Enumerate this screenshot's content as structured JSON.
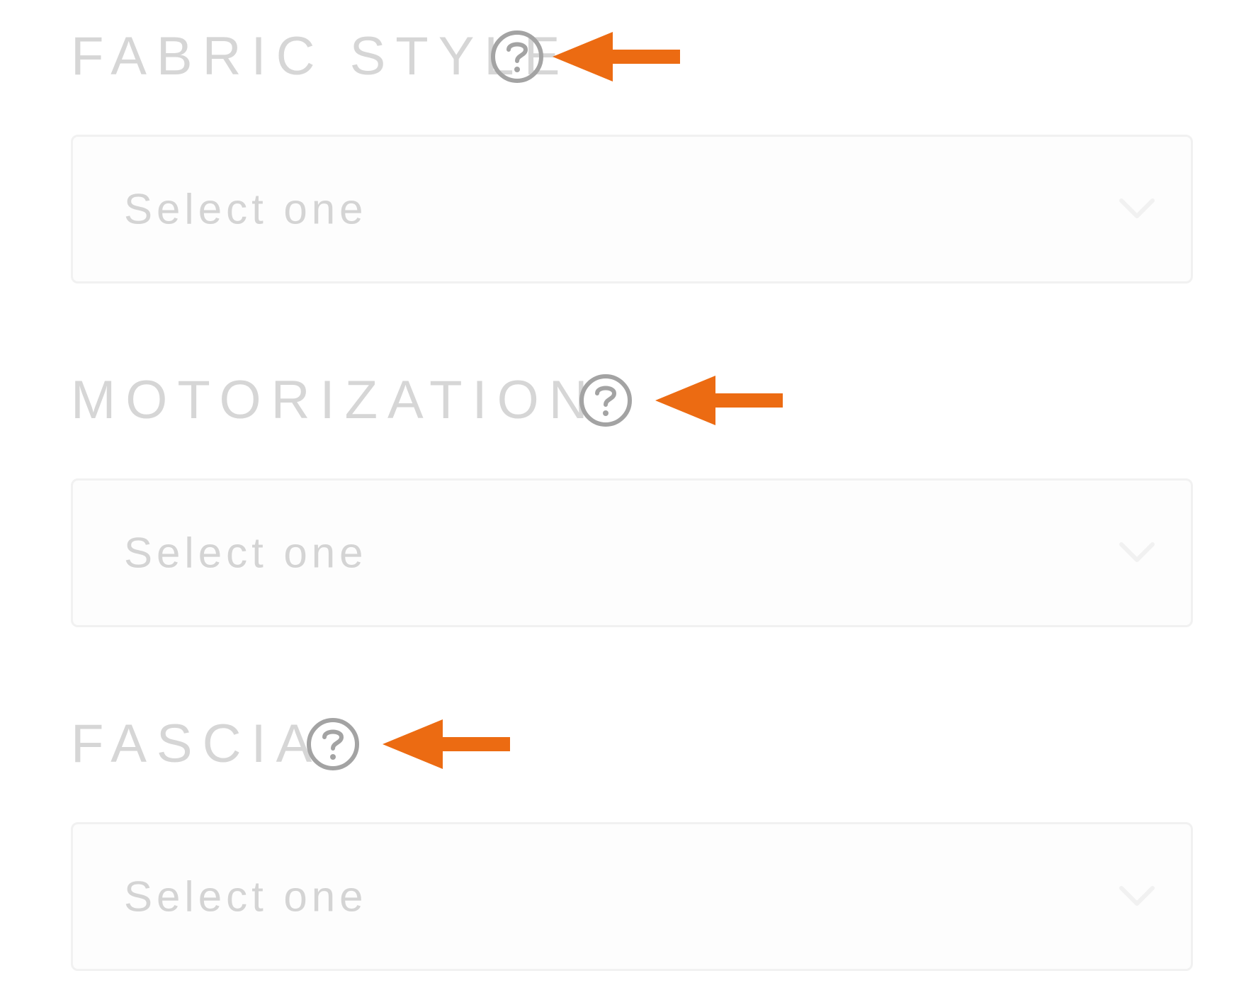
{
  "fields": [
    {
      "label": "FABRIC STYLE",
      "select": {
        "value": "Select one"
      },
      "help_icon": "question-circle-icon",
      "callout": "arrow-left-icon"
    },
    {
      "label": "MOTORIZATION",
      "select": {
        "value": "Select one"
      },
      "help_icon": "question-circle-icon",
      "callout": "arrow-left-icon"
    },
    {
      "label": "FASCIA",
      "select": {
        "value": "Select one"
      },
      "help_icon": "question-circle-icon",
      "callout": "arrow-left-icon"
    }
  ],
  "colors": {
    "label": "#d6d6d6",
    "help_icon": "#a3a3a3",
    "callout_arrow": "#ec6b12",
    "select_border": "#f1f1f1",
    "select_placeholder": "#d4d4d4",
    "chevron": "#f1f1f1"
  }
}
